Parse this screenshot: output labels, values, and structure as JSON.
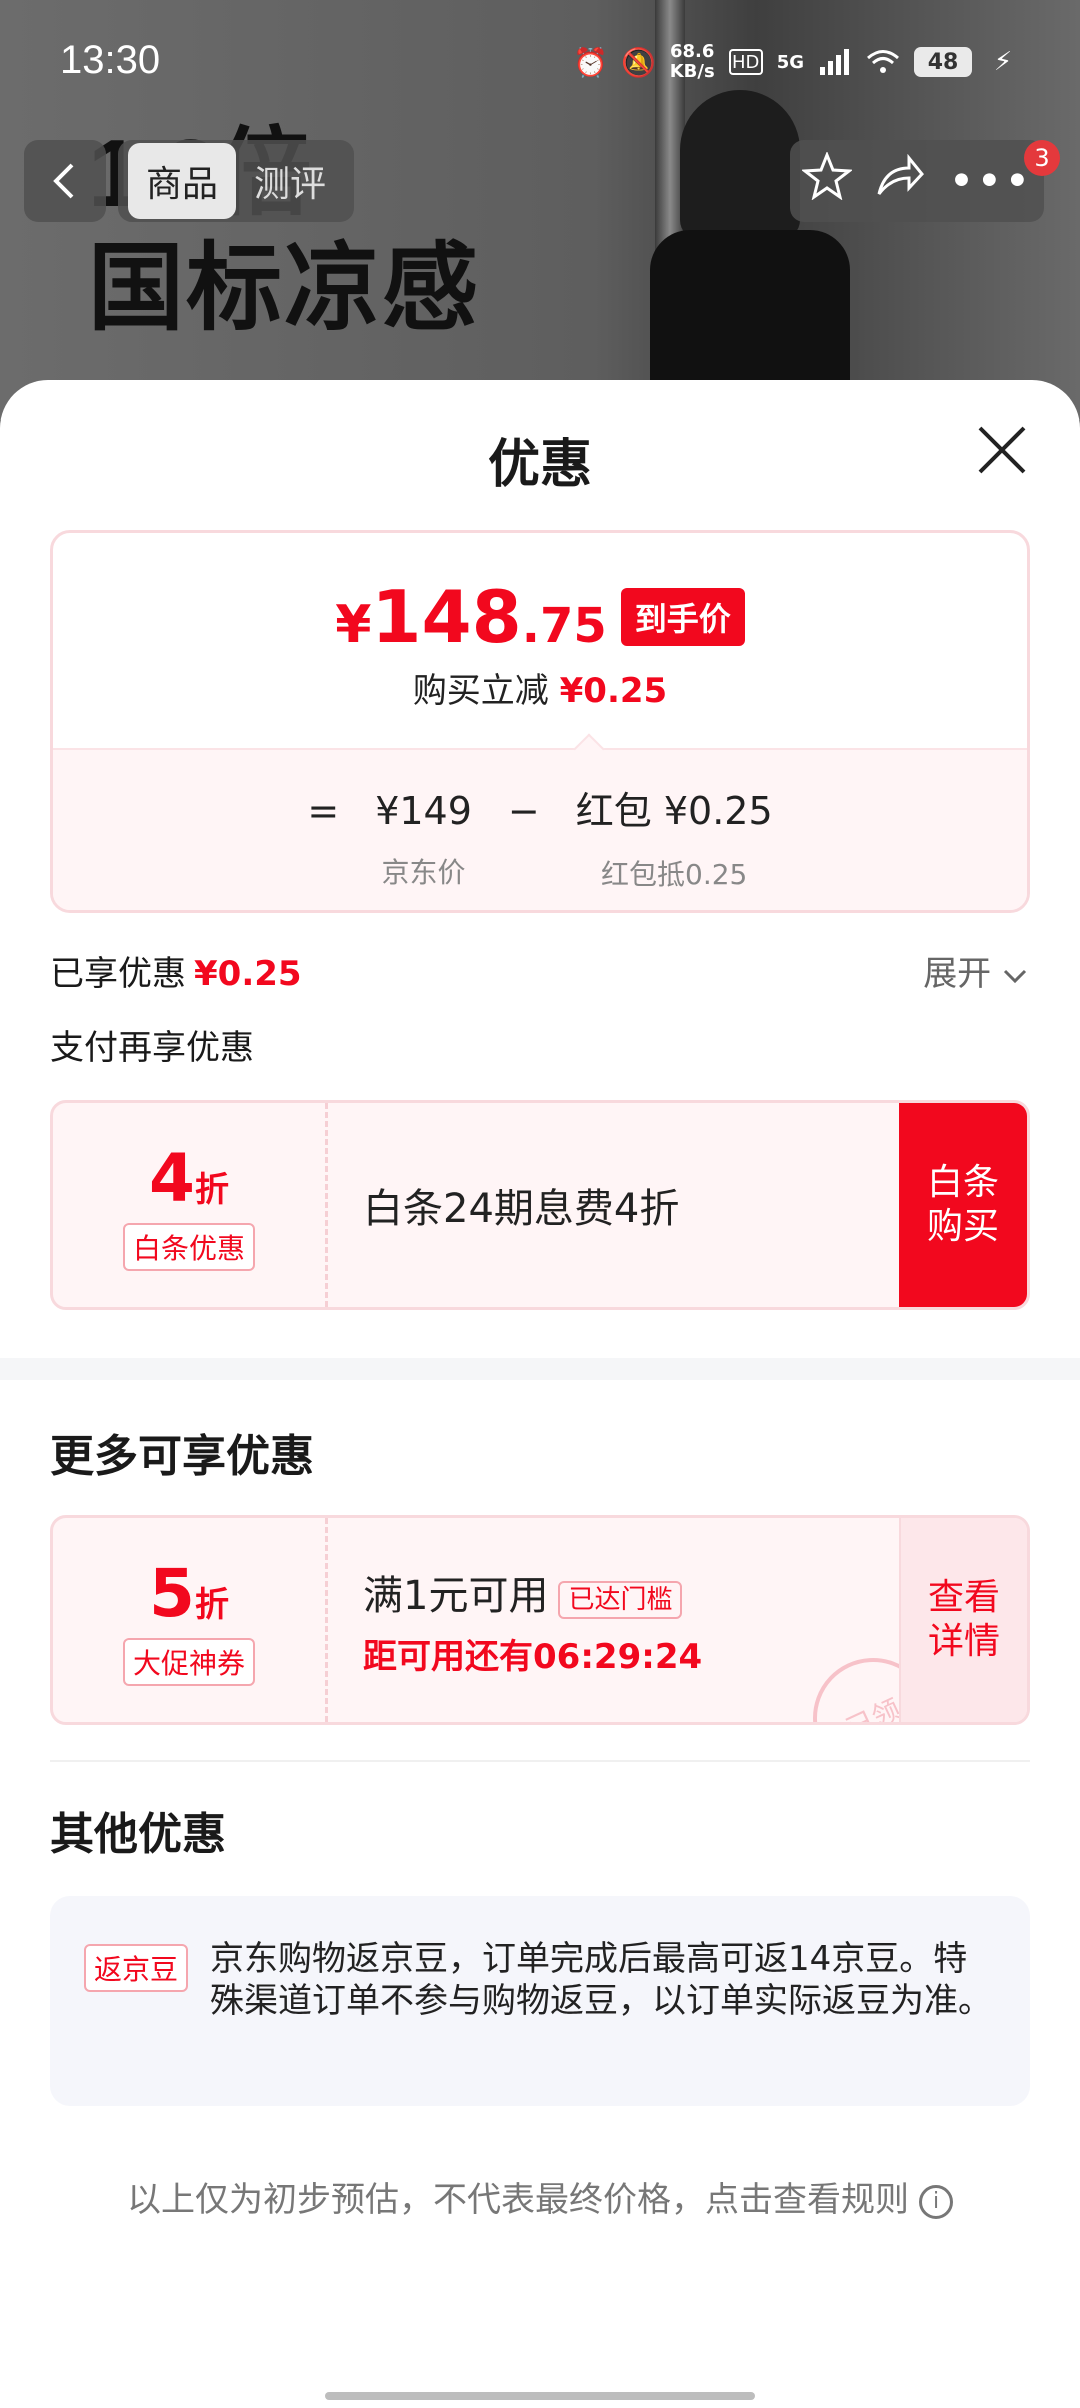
{
  "status_bar": {
    "time": "13:30",
    "net_speed_value": "68.6",
    "net_speed_unit": "KB/s",
    "signal_label": "5G",
    "battery": "48"
  },
  "backdrop": {
    "hero_line1": "1.8倍",
    "hero_line2": "国标凉感"
  },
  "nav": {
    "back_icon": "chevron-left-icon",
    "tabs": [
      {
        "label": "商品",
        "active": true
      },
      {
        "label": "测评",
        "active": false
      }
    ],
    "badge": "3"
  },
  "sheet": {
    "title": "优惠",
    "price": {
      "currency": "¥",
      "integer": "148",
      "decimal": ".75",
      "tag": "到手价",
      "reduce_label": "购买立减",
      "reduce_value": "¥0.25",
      "equals": "=",
      "jd_price": "¥149",
      "minus": "−",
      "redpacket_label": "红包 ¥0.25",
      "jd_price_label": "京东价",
      "redpacket_sub": "红包抵0.25"
    },
    "enjoyed_label": "已享优惠",
    "enjoyed_value": "¥0.25",
    "expand_label": "展开",
    "pay_more_label": "支付再享优惠",
    "baitiao_coupon": {
      "discount_num": "4",
      "discount_unit": "折",
      "tag": "白条优惠",
      "text": "白条24期息费4折",
      "button": "白条购买"
    },
    "more_title": "更多可享优惠",
    "promo_coupon": {
      "discount_num": "5",
      "discount_unit": "折",
      "tag": "大促神券",
      "text": "满1元可用",
      "reached": "已达门槛",
      "countdown": "距可用还有06:29:24",
      "button": "查看详情",
      "stamp": "已领"
    },
    "other_title": "其他优惠",
    "other": {
      "tag": "返京豆",
      "text": "京东购物返京豆，订单完成后最高可返14京豆。特殊渠道订单不参与购物返豆，以订单实际返豆为准。"
    },
    "footer_note": "以上仅为初步预估，不代表最终价格，点击查看规则"
  },
  "colors": {
    "accent": "#f2081e",
    "card_border": "#f8d9dd",
    "card_bg": "#fff5f6"
  }
}
